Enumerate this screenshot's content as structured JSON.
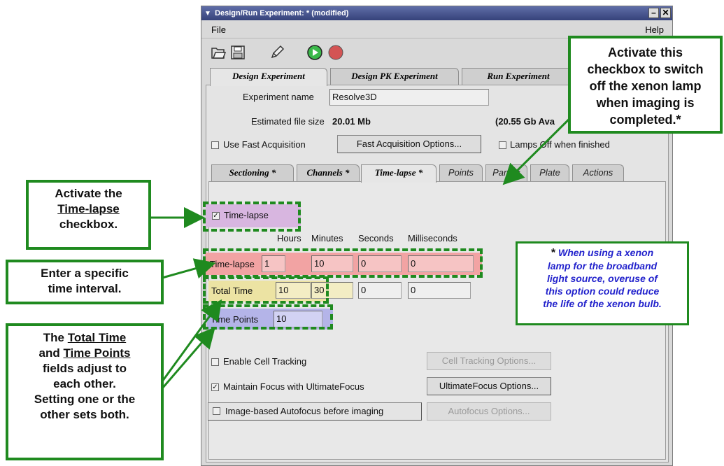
{
  "window": {
    "title": "Design/Run Experiment: * (modified)",
    "minimize_glyph": "–",
    "close_glyph": "✕"
  },
  "menubar": {
    "file": "File",
    "help": "Help"
  },
  "toolbar": {
    "icons": [
      "open-icon",
      "save-icon",
      "edit-icon",
      "run-icon",
      "stop-icon"
    ]
  },
  "top_tabs": [
    "Design Experiment",
    "Design PK Experiment",
    "Run Experiment"
  ],
  "experiment": {
    "name_label": "Experiment name",
    "name_value": "Resolve3D",
    "size_label": "Estimated file size",
    "size_value": "20.01 Mb",
    "available": "(20.55 Gb Ava"
  },
  "fast_acq": {
    "checkbox_label": "Use Fast Acquisition",
    "options_button": "Fast Acquisition Options..."
  },
  "lamps": {
    "label": "Lamps Off when finished",
    "checked": false
  },
  "sub_tabs": [
    "Sectioning *",
    "Channels *",
    "Time-lapse *",
    "Points",
    "Panels",
    "Plate",
    "Actions"
  ],
  "timelapse": {
    "checkbox_label": "Time-lapse",
    "checked": true,
    "headers": [
      "Hours",
      "Minutes",
      "Seconds",
      "Milliseconds"
    ],
    "rows": [
      {
        "label": "Time-lapse",
        "values": [
          "1",
          "10",
          "0",
          "0"
        ]
      },
      {
        "label": "Total Time",
        "values": [
          "10",
          "30",
          "0",
          "0"
        ]
      }
    ],
    "points_label": "Time Points",
    "points_value": "10"
  },
  "tracking": {
    "label": "Enable Cell Tracking",
    "button": "Cell Tracking Options..."
  },
  "focus": {
    "label": "Maintain Focus with UltimateFocus",
    "button": "UltimateFocus Options...",
    "checked": true
  },
  "autofocus": {
    "label": "Image-based Autofocus before imaging",
    "button": "Autofocus Options..."
  },
  "callouts": {
    "lamp": [
      "Activate this",
      "checkbox to switch",
      "off the xenon lamp",
      "when imaging is",
      "completed.*"
    ],
    "timelapse": [
      "Activate the",
      "Time-lapse",
      "checkbox."
    ],
    "interval": [
      "Enter a specific",
      "time interval."
    ],
    "total": [
      "The",
      "Total Time",
      "and",
      "Time Points",
      "fields adjust to",
      "each other.",
      "Setting one or the",
      "other sets both."
    ]
  },
  "note": {
    "star": "*",
    "lines": [
      "When using a xenon",
      "lamp for the broadband",
      "light source, overuse of",
      "this option could reduce",
      "the life of the xenon bulb."
    ]
  },
  "colors": {
    "callout_border": "#1f8a1f",
    "timelapse_check_highlight": "#d8b6e0",
    "timelapse_row_highlight": "#f2a3a3",
    "total_time_highlight": "#ece3a3",
    "time_points_highlight": "#b4b4e8",
    "note_text": "#2222cc"
  }
}
